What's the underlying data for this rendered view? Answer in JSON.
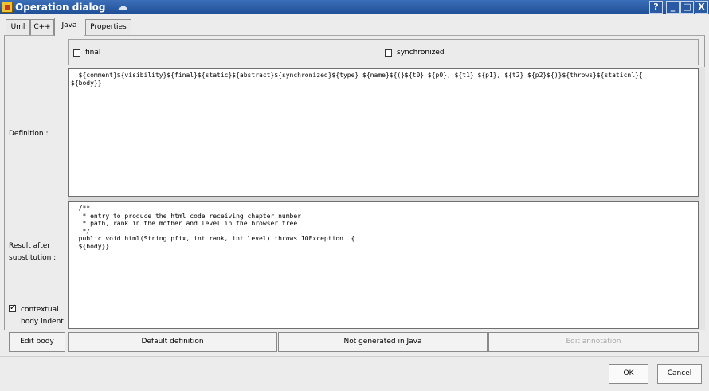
{
  "window": {
    "title": "Operation dialog",
    "controls": {
      "help": "?",
      "minimize": "_",
      "maximize": "□",
      "close": "X"
    }
  },
  "tabs": [
    {
      "label": "Uml"
    },
    {
      "label": "C++"
    },
    {
      "label": "Java",
      "active": true
    },
    {
      "label": "Properties"
    }
  ],
  "options": {
    "final_label": "final",
    "final_checked": false,
    "synchronized_label": "synchronized",
    "synchronized_checked": false
  },
  "definition": {
    "label": "Definition :",
    "text": "  ${comment}${visibility}${final}${static}${abstract}${synchronized}${type} ${name}${(}${t0} ${p0}, ${t1} ${p1}, ${t2} ${p2}${)}${throws}${staticnl}{\n${body}}"
  },
  "result": {
    "label_line1": "Result after",
    "label_line2": "substitution :",
    "text": "  /**\n   * entry to produce the html code receiving chapter number\n   * path, rank in the mother and level in the browser tree\n   */\n  public void html(String pfix, int rank, int level) throws IOException  {\n  ${body}}"
  },
  "contextual_indent": {
    "label_line1": "contextual",
    "label_line2": "body indent",
    "checked": true
  },
  "buttons": {
    "edit_body": "Edit body",
    "default_definition": "Default definition",
    "not_generated": "Not generated in Java",
    "edit_annotation": "Edit annotation",
    "ok": "OK",
    "cancel": "Cancel"
  },
  "colors": {
    "titlebar": "#2a5aa3",
    "window_bg": "#ececec",
    "disabled_text": "#a8a8a8"
  }
}
